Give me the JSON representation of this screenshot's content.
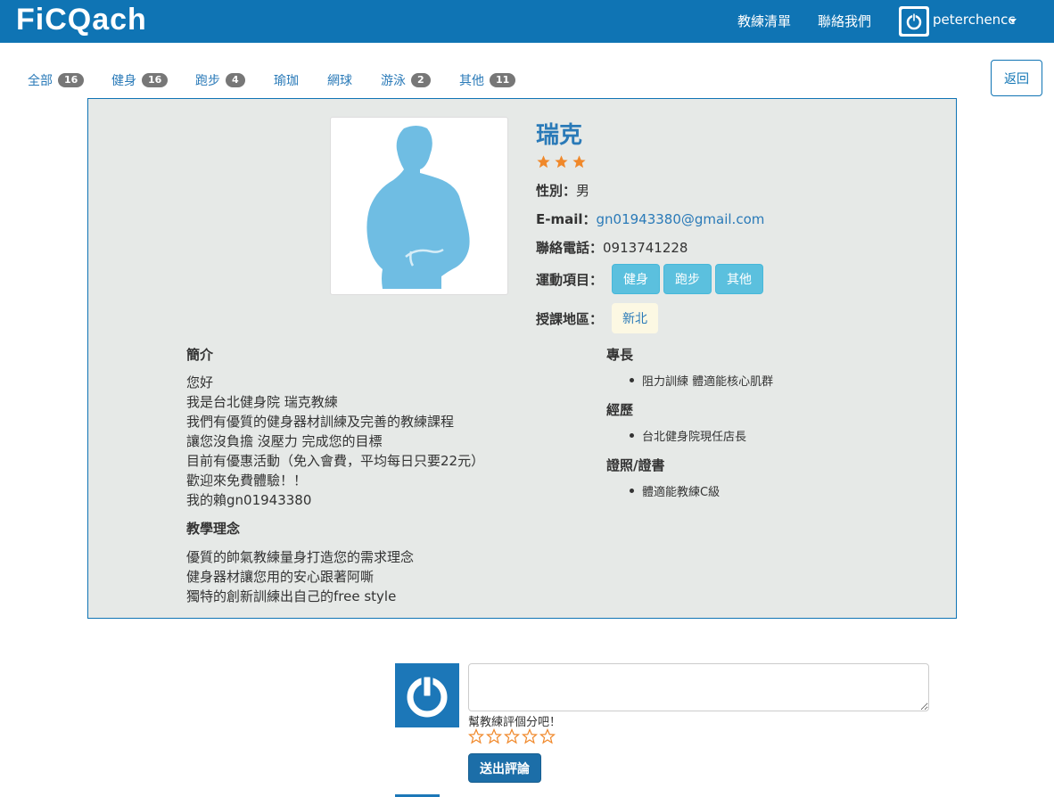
{
  "nav": {
    "logo": "FiCQach",
    "links": [
      "教練清單",
      "聯絡我們"
    ],
    "username": "peterchencc"
  },
  "filters": [
    {
      "label": "全部",
      "count": "16"
    },
    {
      "label": "健身",
      "count": "16"
    },
    {
      "label": "跑步",
      "count": "4"
    },
    {
      "label": "瑜珈",
      "count": ""
    },
    {
      "label": "網球",
      "count": ""
    },
    {
      "label": "游泳",
      "count": "2"
    },
    {
      "label": "其他",
      "count": "11"
    }
  ],
  "back_label": "返回",
  "coach": {
    "name": "瑞克",
    "rating": 3,
    "gender_label": "性別：",
    "gender": "男",
    "email_label": "E-mail：",
    "email": "gn01943380@gmail.com",
    "phone_label": "聯絡電話：",
    "phone": "0913741228",
    "sports_label": "運動項目：",
    "sports": [
      "健身",
      "跑步",
      "其他"
    ],
    "area_label": "授課地區：",
    "area": "新北"
  },
  "intro": {
    "title": "簡介",
    "lines": [
      "您好",
      "我是台北健身院 瑞克教練",
      "我們有優質的健身器材訓練及完善的教練課程",
      "讓您沒負擔 沒壓力 完成您的目標",
      "目前有優惠活動（免入會費，平均每日只要22元）",
      "歡迎來免費體驗！！",
      "我的賴gn01943380"
    ]
  },
  "philosophy": {
    "title": "教學理念",
    "lines": [
      "優質的帥氣教練量身打造您的需求理念",
      "健身器材讓您用的安心跟著阿嘶",
      "獨特的創新訓練出自己的free style"
    ]
  },
  "specialty": {
    "title": "專長",
    "items": [
      "阻力訓練 體適能核心肌群"
    ]
  },
  "experience": {
    "title": "經歷",
    "items": [
      "台北健身院現任店長"
    ]
  },
  "certificates": {
    "title": "證照/證書",
    "items": [
      "體適能教練C級"
    ]
  },
  "comment": {
    "placeholder": "",
    "hint": "幫教練評個分吧！",
    "submit": "送出評論"
  },
  "colors": {
    "primary": "#0f74b4",
    "panel_bg": "#e6e9e7",
    "info_tag": "#5bc0de",
    "star": "#f0882a"
  }
}
